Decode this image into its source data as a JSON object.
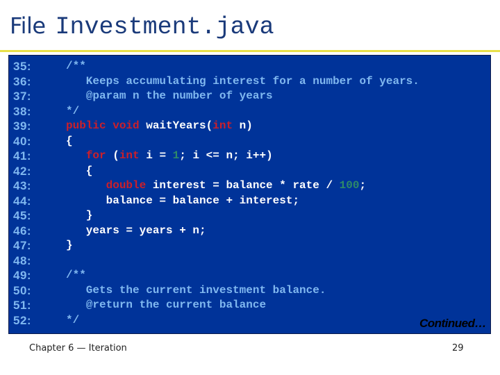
{
  "header": {
    "title_word": "File",
    "file_name": "Investment.java"
  },
  "code": {
    "lines": [
      {
        "num": "35:",
        "tokens": [
          {
            "t": "/**",
            "c": "cmt"
          }
        ]
      },
      {
        "num": "36:",
        "tokens": [
          {
            "t": "   Keeps accumulating interest for a number of years.",
            "c": "cmt"
          }
        ]
      },
      {
        "num": "37:",
        "tokens": [
          {
            "t": "   @param n the number of years",
            "c": "cmt"
          }
        ]
      },
      {
        "num": "38:",
        "tokens": [
          {
            "t": "*/",
            "c": "cmt"
          }
        ]
      },
      {
        "num": "39:",
        "tokens": [
          {
            "t": "public void",
            "c": "kw"
          },
          {
            "t": " waitYears(",
            "c": "txt"
          },
          {
            "t": "int",
            "c": "kw"
          },
          {
            "t": " n)",
            "c": "txt"
          }
        ]
      },
      {
        "num": "40:",
        "tokens": [
          {
            "t": "{",
            "c": "txt"
          }
        ]
      },
      {
        "num": "41:",
        "tokens": [
          {
            "t": "   ",
            "c": "txt"
          },
          {
            "t": "for",
            "c": "kw"
          },
          {
            "t": " (",
            "c": "txt"
          },
          {
            "t": "int",
            "c": "kw"
          },
          {
            "t": " i = ",
            "c": "txt"
          },
          {
            "t": "1",
            "c": "num"
          },
          {
            "t": "; i <= n; i++)",
            "c": "txt"
          }
        ]
      },
      {
        "num": "42:",
        "tokens": [
          {
            "t": "   {",
            "c": "txt"
          }
        ]
      },
      {
        "num": "43:",
        "tokens": [
          {
            "t": "      ",
            "c": "txt"
          },
          {
            "t": "double",
            "c": "kw"
          },
          {
            "t": " interest = balance * rate / ",
            "c": "txt"
          },
          {
            "t": "100",
            "c": "num"
          },
          {
            "t": ";",
            "c": "txt"
          }
        ]
      },
      {
        "num": "44:",
        "tokens": [
          {
            "t": "      balance = balance + interest;",
            "c": "txt"
          }
        ]
      },
      {
        "num": "45:",
        "tokens": [
          {
            "t": "   }",
            "c": "txt"
          }
        ]
      },
      {
        "num": "46:",
        "tokens": [
          {
            "t": "   years = years + n;",
            "c": "txt"
          }
        ]
      },
      {
        "num": "47:",
        "tokens": [
          {
            "t": "}",
            "c": "txt"
          }
        ]
      },
      {
        "num": "48:",
        "tokens": []
      },
      {
        "num": "49:",
        "tokens": [
          {
            "t": "/**",
            "c": "cmt"
          }
        ]
      },
      {
        "num": "50:",
        "tokens": [
          {
            "t": "   Gets the current investment balance.",
            "c": "cmt"
          }
        ]
      },
      {
        "num": "51:",
        "tokens": [
          {
            "t": "   @return the current balance",
            "c": "cmt"
          }
        ]
      },
      {
        "num": "52:",
        "tokens": [
          {
            "t": "*/",
            "c": "cmt"
          }
        ]
      }
    ],
    "continued_label": "Continued…"
  },
  "footer": {
    "chapter": "Chapter 6 — Iteration",
    "page_number": "29"
  },
  "colors": {
    "panel_bg": "#003399",
    "comment": "#80b8f0",
    "keyword": "#cc1f2a",
    "number": "#2e8a68",
    "code_text": "#ffffff",
    "rule": "#e8e04a",
    "title": "#1a3a7a"
  }
}
